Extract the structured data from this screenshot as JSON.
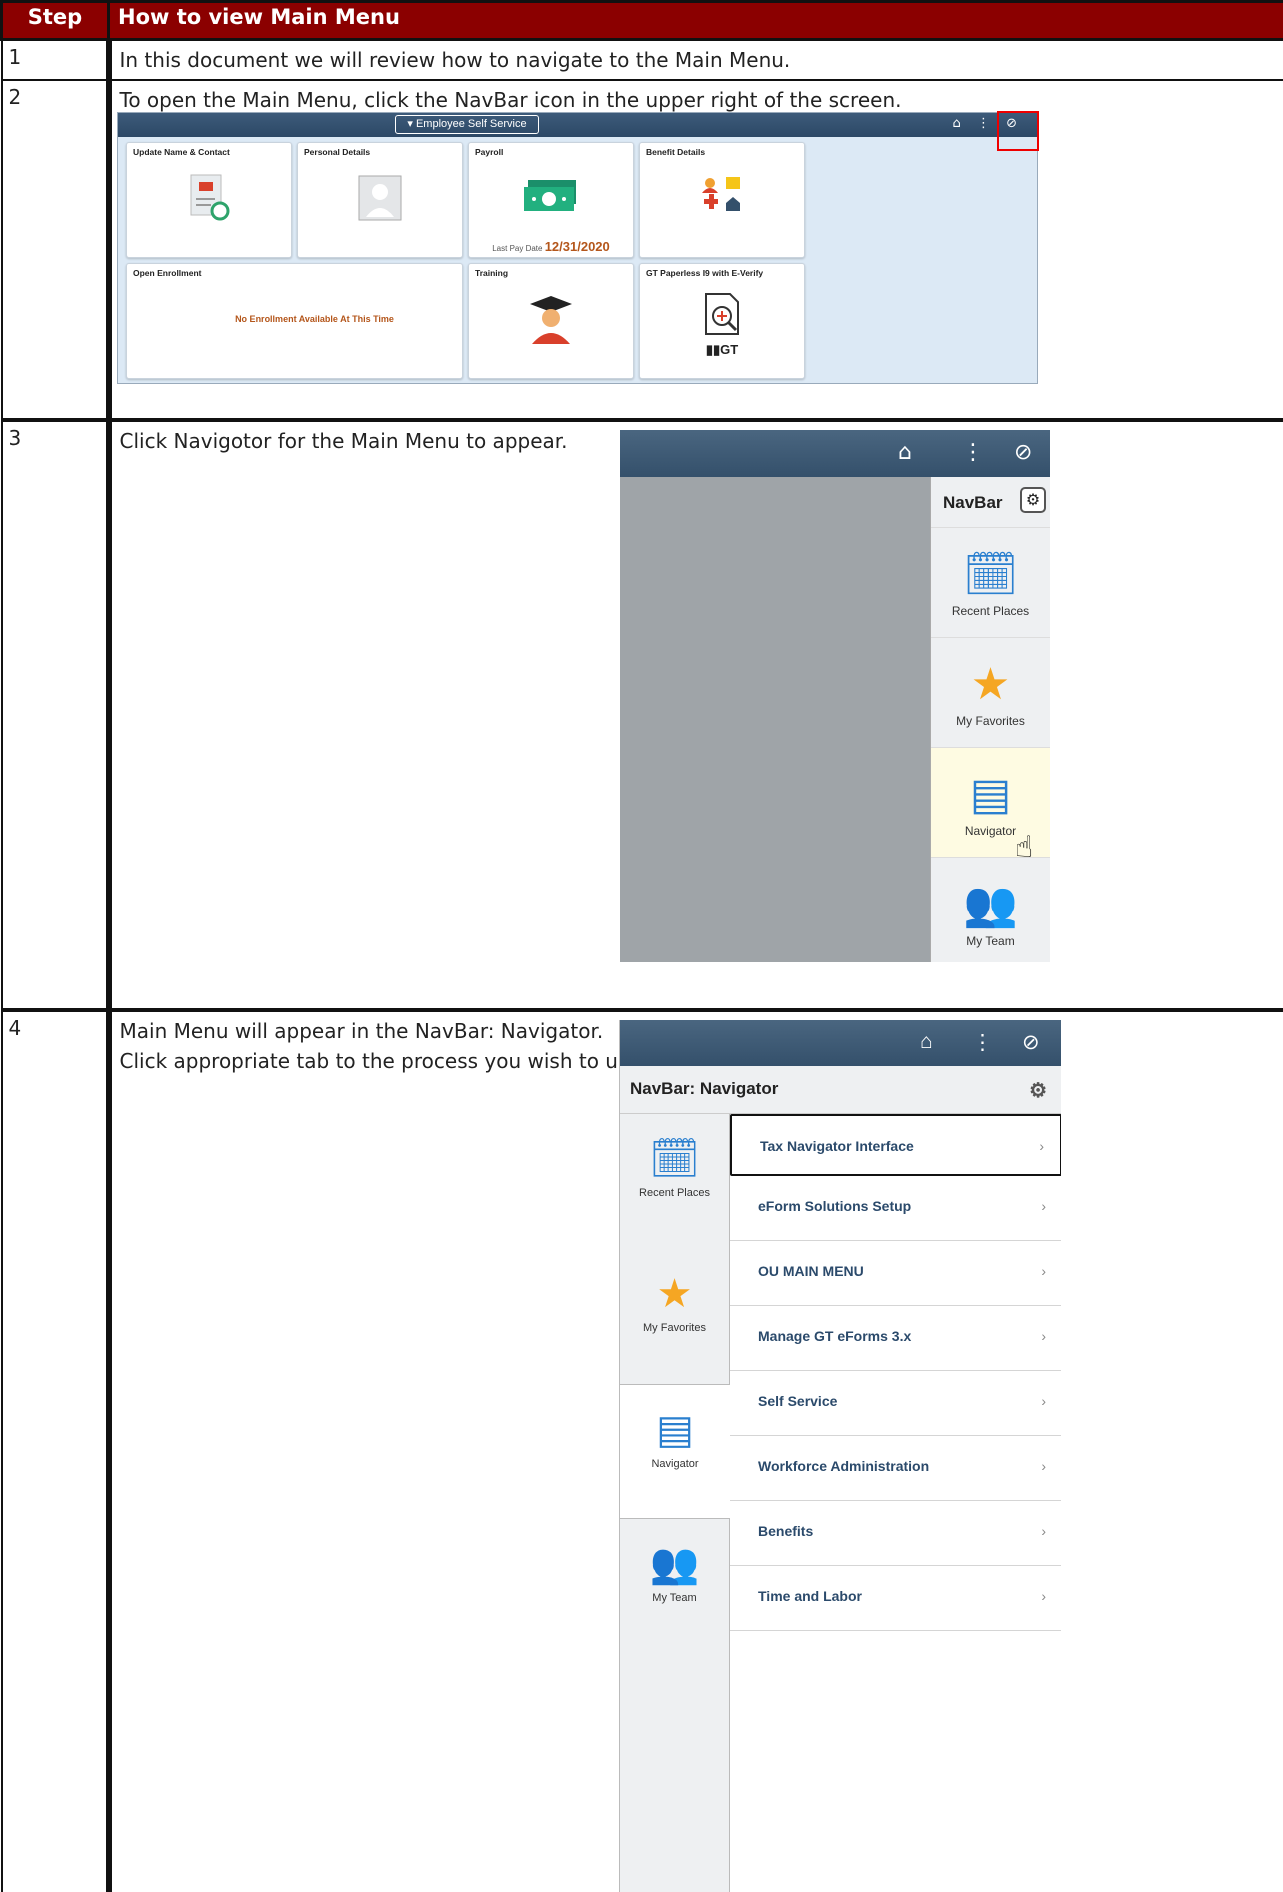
{
  "header": {
    "step": "Step",
    "title": "How to view Main Menu"
  },
  "rows": [
    {
      "step": "1",
      "text": "In this document we will review how to navigate to the Main Menu."
    },
    {
      "step": "2",
      "text": "To open the Main Menu, click the NavBar icon in the upper right of the screen."
    },
    {
      "step": "3",
      "text": "Click Navigotor for the Main Menu to appear."
    },
    {
      "step": "4",
      "text": "Main Menu will appear in the NavBar: Navigator.",
      "text2": "Click appropriate tab to the process you wish to use."
    }
  ],
  "ess": {
    "title": "▾ Employee Self Service",
    "tiles": {
      "update_name": "Update Name & Contact",
      "personal": "Personal Details",
      "payroll": "Payroll",
      "benefit": "Benefit Details",
      "enrollment": "Open Enrollment",
      "training": "Training",
      "paperless": "GT Paperless I9 with E-Verify"
    },
    "last_pay_label": "Last Pay Date",
    "last_pay_date": "12/31/2020",
    "no_enrollment": "No Enrollment Available At This Time",
    "gt_label": "▮▮GT"
  },
  "navbar3": {
    "title": "NavBar",
    "items": [
      "Recent Places",
      "My Favorites",
      "Navigator",
      "My Team"
    ]
  },
  "navbar4": {
    "title": "NavBar: Navigator",
    "left": [
      "Recent Places",
      "My Favorites",
      "Navigator",
      "My Team"
    ],
    "menu": [
      "Tax Navigator Interface",
      "eForm Solutions Setup",
      "OU MAIN MENU",
      "Manage GT eForms 3.x",
      "Self Service",
      "Workforce Administration",
      "Benefits",
      "Time and Labor"
    ]
  },
  "colors": {
    "header_bg": "#8b0000",
    "navbar": "#34506b",
    "accent": "#b4561b"
  }
}
